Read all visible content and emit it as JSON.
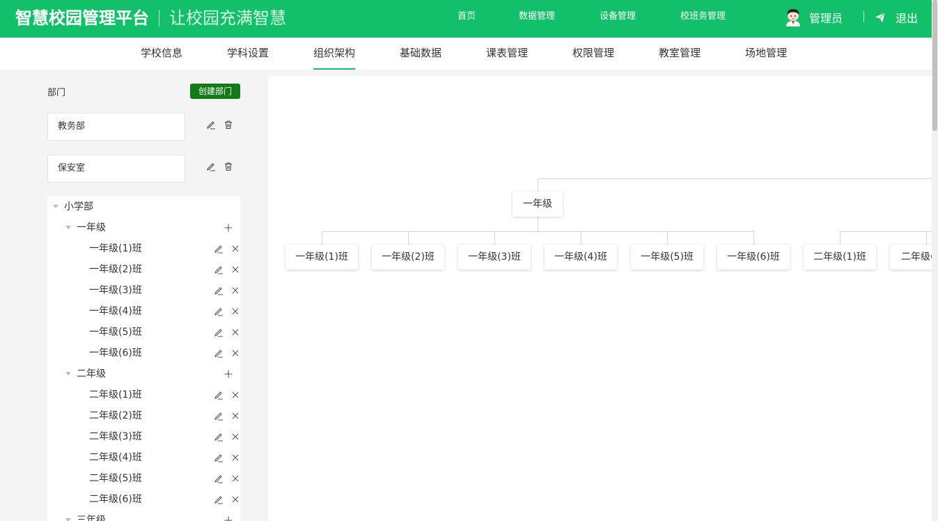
{
  "header": {
    "app_name": "智慧校园管理平台",
    "slogan": "让校园充满智慧",
    "nav": [
      "首页",
      "数据管理",
      "设备管理",
      "校班务管理"
    ],
    "user_name": "管理员",
    "logout_label": "退出",
    "brand_color": "#13c06a"
  },
  "subnav": {
    "items": [
      "学校信息",
      "学科设置",
      "组织架构",
      "基础数据",
      "课表管理",
      "权限管理",
      "教室管理",
      "场地管理"
    ],
    "active": "组织架构"
  },
  "sidebar": {
    "title": "部门",
    "create_button": "创建部门",
    "departments": [
      "教务部",
      "保安室"
    ],
    "tree": {
      "root": "小学部",
      "grades": [
        {
          "label": "一年级",
          "classes": [
            "一年级(1)班",
            "一年级(2)班",
            "一年级(3)班",
            "一年级(4)班",
            "一年级(5)班",
            "一年级(6)班"
          ]
        },
        {
          "label": "二年级",
          "classes": [
            "二年级(1)班",
            "二年级(2)班",
            "二年级(3)班",
            "二年级(4)班",
            "二年级(5)班",
            "二年级(6)班"
          ]
        },
        {
          "label": "三年级",
          "classes": []
        }
      ]
    }
  },
  "org_chart": {
    "grade_node": "一年级",
    "class_nodes": [
      "一年级(1)班",
      "一年级(2)班",
      "一年级(3)班",
      "一年级(4)班",
      "一年级(5)班",
      "一年级(6)班",
      "二年级(1)班",
      "二年级("
    ]
  },
  "icons": {
    "edit": "pencil-icon",
    "delete_dept": "trash-icon",
    "delete_class": "close-icon",
    "add": "plus-icon",
    "logout": "send-icon",
    "caret": "caret-down-icon"
  }
}
